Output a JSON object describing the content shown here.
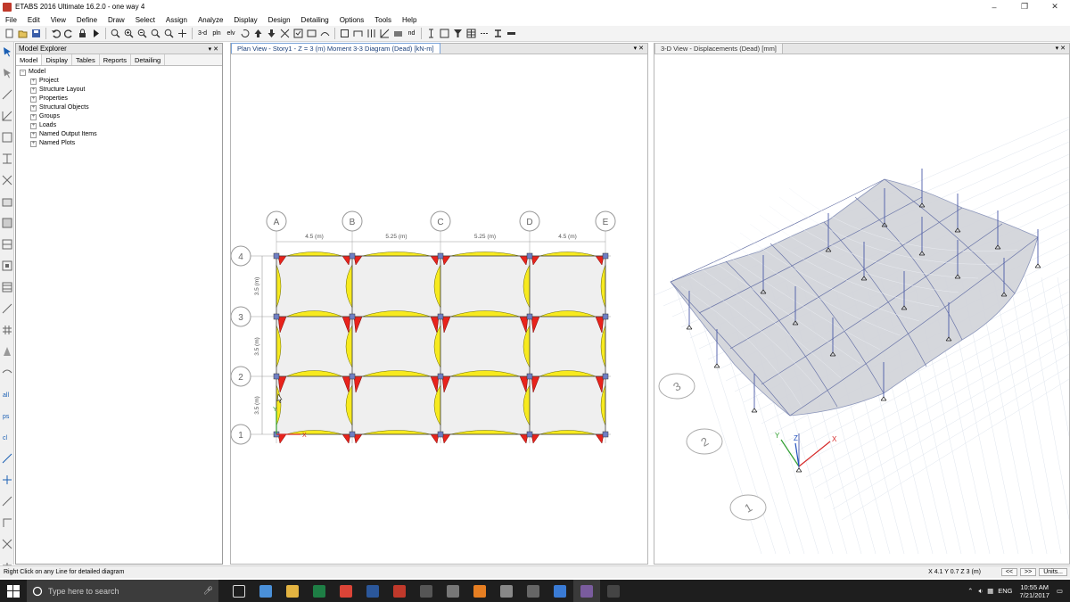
{
  "window": {
    "title": "ETABS 2016 Ultimate 16.2.0 - one way 4",
    "minimize": "–",
    "restore": "❐",
    "close": "✕"
  },
  "menu": [
    "File",
    "Edit",
    "View",
    "Define",
    "Draw",
    "Select",
    "Assign",
    "Analyze",
    "Display",
    "Design",
    "Detailing",
    "Options",
    "Tools",
    "Help"
  ],
  "toolbar": {
    "view_3d": "3-d",
    "plan_view": "pln",
    "elev_view": "elv",
    "nd_label": "nd"
  },
  "explorer": {
    "title": "Model Explorer",
    "tabs": [
      "Model",
      "Display",
      "Tables",
      "Reports",
      "Detailing"
    ],
    "root": "Model",
    "items": [
      "Project",
      "Structure Layout",
      "Properties",
      "Structural Objects",
      "Groups",
      "Loads",
      "Named Output Items",
      "Named Plots"
    ]
  },
  "plan_view": {
    "tab_label": "Plan View - Story1 - Z = 3 (m)   Moment 3-3 Diagram  (Dead)  [kN-m]",
    "grid_x": [
      "A",
      "B",
      "C",
      "D",
      "E"
    ],
    "grid_y": [
      "4",
      "3",
      "2",
      "1"
    ],
    "spans_x": [
      "4.5 (m)",
      "5.25 (m)",
      "5.25 (m)",
      "4.5 (m)"
    ],
    "spans_y": [
      "3.5 (m)",
      "3.5 (m)",
      "3.5 (m)"
    ],
    "axis_x": "X",
    "axis_y": "Y"
  },
  "view_3d": {
    "tab_label": "3-D View  - Displacements (Dead)  [mm]",
    "grid_bubbles": [
      "3",
      "2",
      "1"
    ],
    "axis_x": "X",
    "axis_y": "Y",
    "axis_z": "Z"
  },
  "status": {
    "message": "Right Click on any Line for detailed diagram",
    "coords": "X 4.1  Y 0.7  Z 3 (m)",
    "prev": "<<",
    "next": ">>",
    "units": "Units..."
  },
  "taskbar": {
    "search_placeholder": "Type here to search",
    "language": "ENG",
    "time": "10:55 AM",
    "date": "7/21/2017",
    "app_colors": [
      "#4a90d9",
      "#e3b341",
      "#1e7e45",
      "#db4437",
      "#2b579a",
      "#c0392b",
      "#555555",
      "#777777",
      "#e67e22",
      "#888888",
      "#666666",
      "#3a7bd5",
      "#7a5c9e",
      "#444444"
    ]
  },
  "colors": {
    "positive_moment": "#f7ea1f",
    "negative_moment": "#e8231c",
    "column": "#6f7fc4",
    "slab": "#efefef",
    "accent": "#1a3f7a"
  }
}
